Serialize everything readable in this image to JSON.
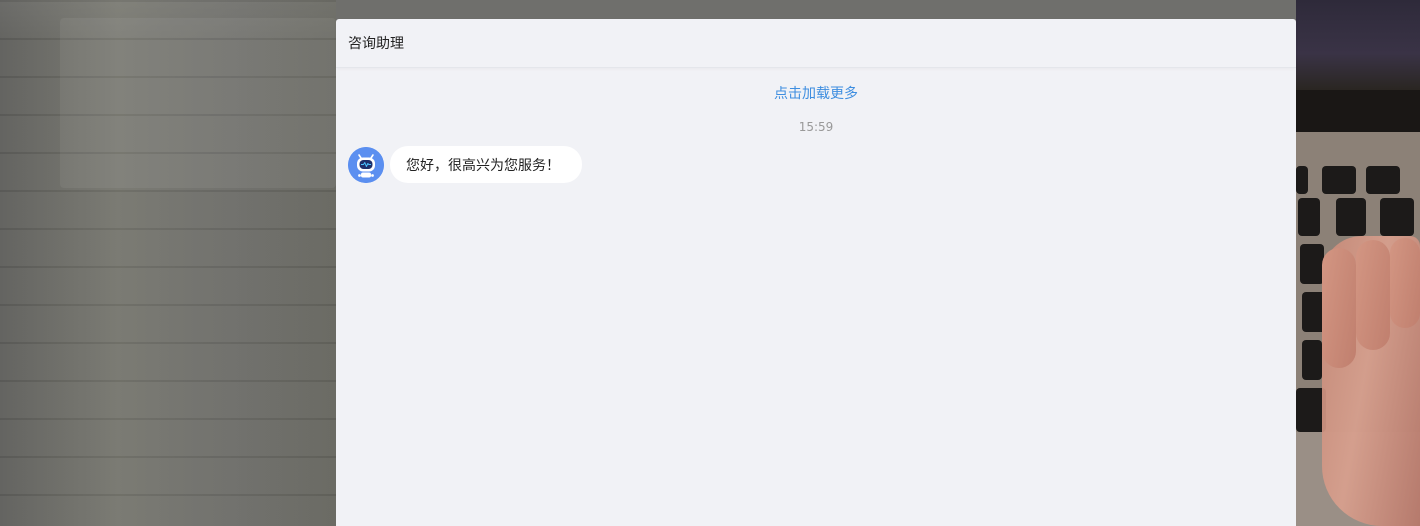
{
  "chat": {
    "title": "咨询助理",
    "load_more_label": "点击加载更多",
    "timestamp": "15:59",
    "messages": [
      {
        "sender": "bot",
        "avatar_icon": "robot-icon",
        "text": "您好，很高兴为您服务！"
      }
    ]
  },
  "colors": {
    "accent_link": "#3e8ee0",
    "chat_background": "#f1f2f6",
    "bubble_background": "#ffffff",
    "avatar_background": "#5b8ff0"
  }
}
